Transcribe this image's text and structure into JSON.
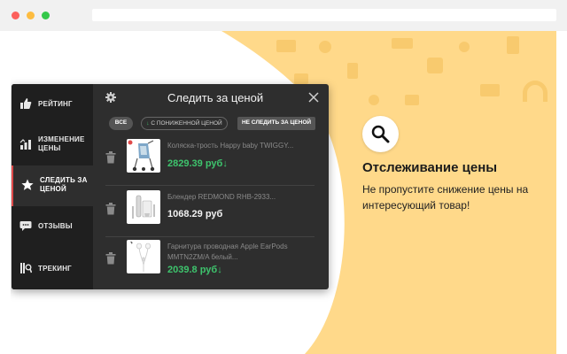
{
  "panel": {
    "title": "Следить за ценой",
    "sidebar": [
      {
        "label": "РЕЙТИНГ",
        "icon": "thumbs-up-icon"
      },
      {
        "label": "ИЗМЕНЕНИЕ ЦЕНЫ",
        "icon": "price-change-icon"
      },
      {
        "label": "СЛЕДИТЬ ЗА ЦЕНОЙ",
        "icon": "star-icon",
        "active": true
      },
      {
        "label": "ОТЗЫВЫ",
        "icon": "chat-bubble-icon"
      },
      {
        "label": "ТРЕКИНГ",
        "icon": "tracking-icon"
      }
    ],
    "filters": {
      "all": "ВСЕ",
      "lower_arrow": "↓",
      "lower": "С ПОНИЖЕННОЙ ЦЕНОЙ",
      "no_follow": "НЕ СЛЕДИТЬ ЗА ЦЕНОЙ"
    },
    "items": [
      {
        "name": "Коляска-трость Happy baby TWIGGY...",
        "price": "2829.39 руб",
        "arrow": "↓",
        "price_color": "#3ec46d",
        "marker": true
      },
      {
        "name": "Блендер REDMOND RHB-2933...",
        "price": "1068.29 руб",
        "arrow": "",
        "price_color": "#f2f2f2",
        "marker": false
      },
      {
        "name": "Гарнитура проводная Apple EarPods MMTN2ZM/A белый...",
        "price": "2039.8 руб",
        "arrow": "↓",
        "price_color": "#3ec46d",
        "marker": false
      }
    ]
  },
  "feature": {
    "title": "Отслеживание цены",
    "desc": "Не пропустите снижение цены на интересующий товар!"
  },
  "colors": {
    "accent_red": "#e04a4a",
    "price_green": "#3ec46d",
    "background_yellow": "#ffd98a"
  }
}
